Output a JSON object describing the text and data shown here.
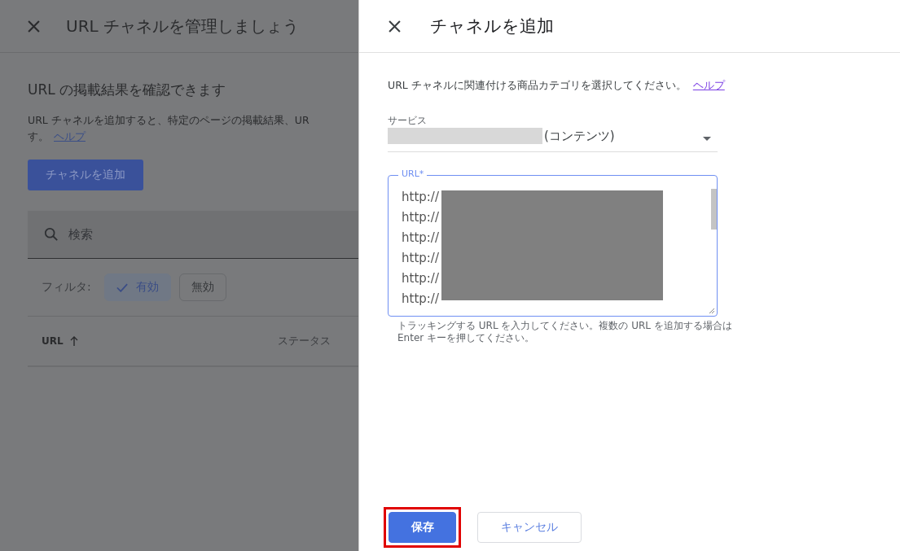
{
  "background_page": {
    "title": "URL チャネルを管理しましょう",
    "heading": "URL の掲載結果を確認できます",
    "description_lines": [
      "URL チャネルを追加すると、特定のページの掲載結果、UR",
      "す。"
    ],
    "help_link": "ヘルプ",
    "add_button": "チャネルを追加",
    "search": {
      "placeholder": "検索"
    },
    "filter_label": "フィルタ:",
    "filters": [
      {
        "label": "有効",
        "selected": true
      },
      {
        "label": "無効",
        "selected": false
      }
    ],
    "columns": [
      {
        "label": "URL",
        "sorted": true
      },
      {
        "label": "ステータス",
        "sorted": false
      }
    ]
  },
  "dialog": {
    "title": "チャネルを追加",
    "instruction": "URL チャネルに関連付ける商品カテゴリを選択してください。",
    "help_link": "ヘルプ",
    "service": {
      "label": "サービス",
      "value": "(コンテンツ)"
    },
    "url_field": {
      "label": "URL*",
      "lines": [
        "http://",
        "http://",
        "http://",
        "http://",
        "http://",
        "http://"
      ],
      "hint": "トラッキングする URL を入力してください。複数の URL を追加する場合は Enter キーを押してください。"
    },
    "buttons": [
      {
        "label": "保存",
        "kind": "primary",
        "highlighted": true
      },
      {
        "label": "キャンセル",
        "kind": "secondary",
        "highlighted": false
      }
    ]
  }
}
